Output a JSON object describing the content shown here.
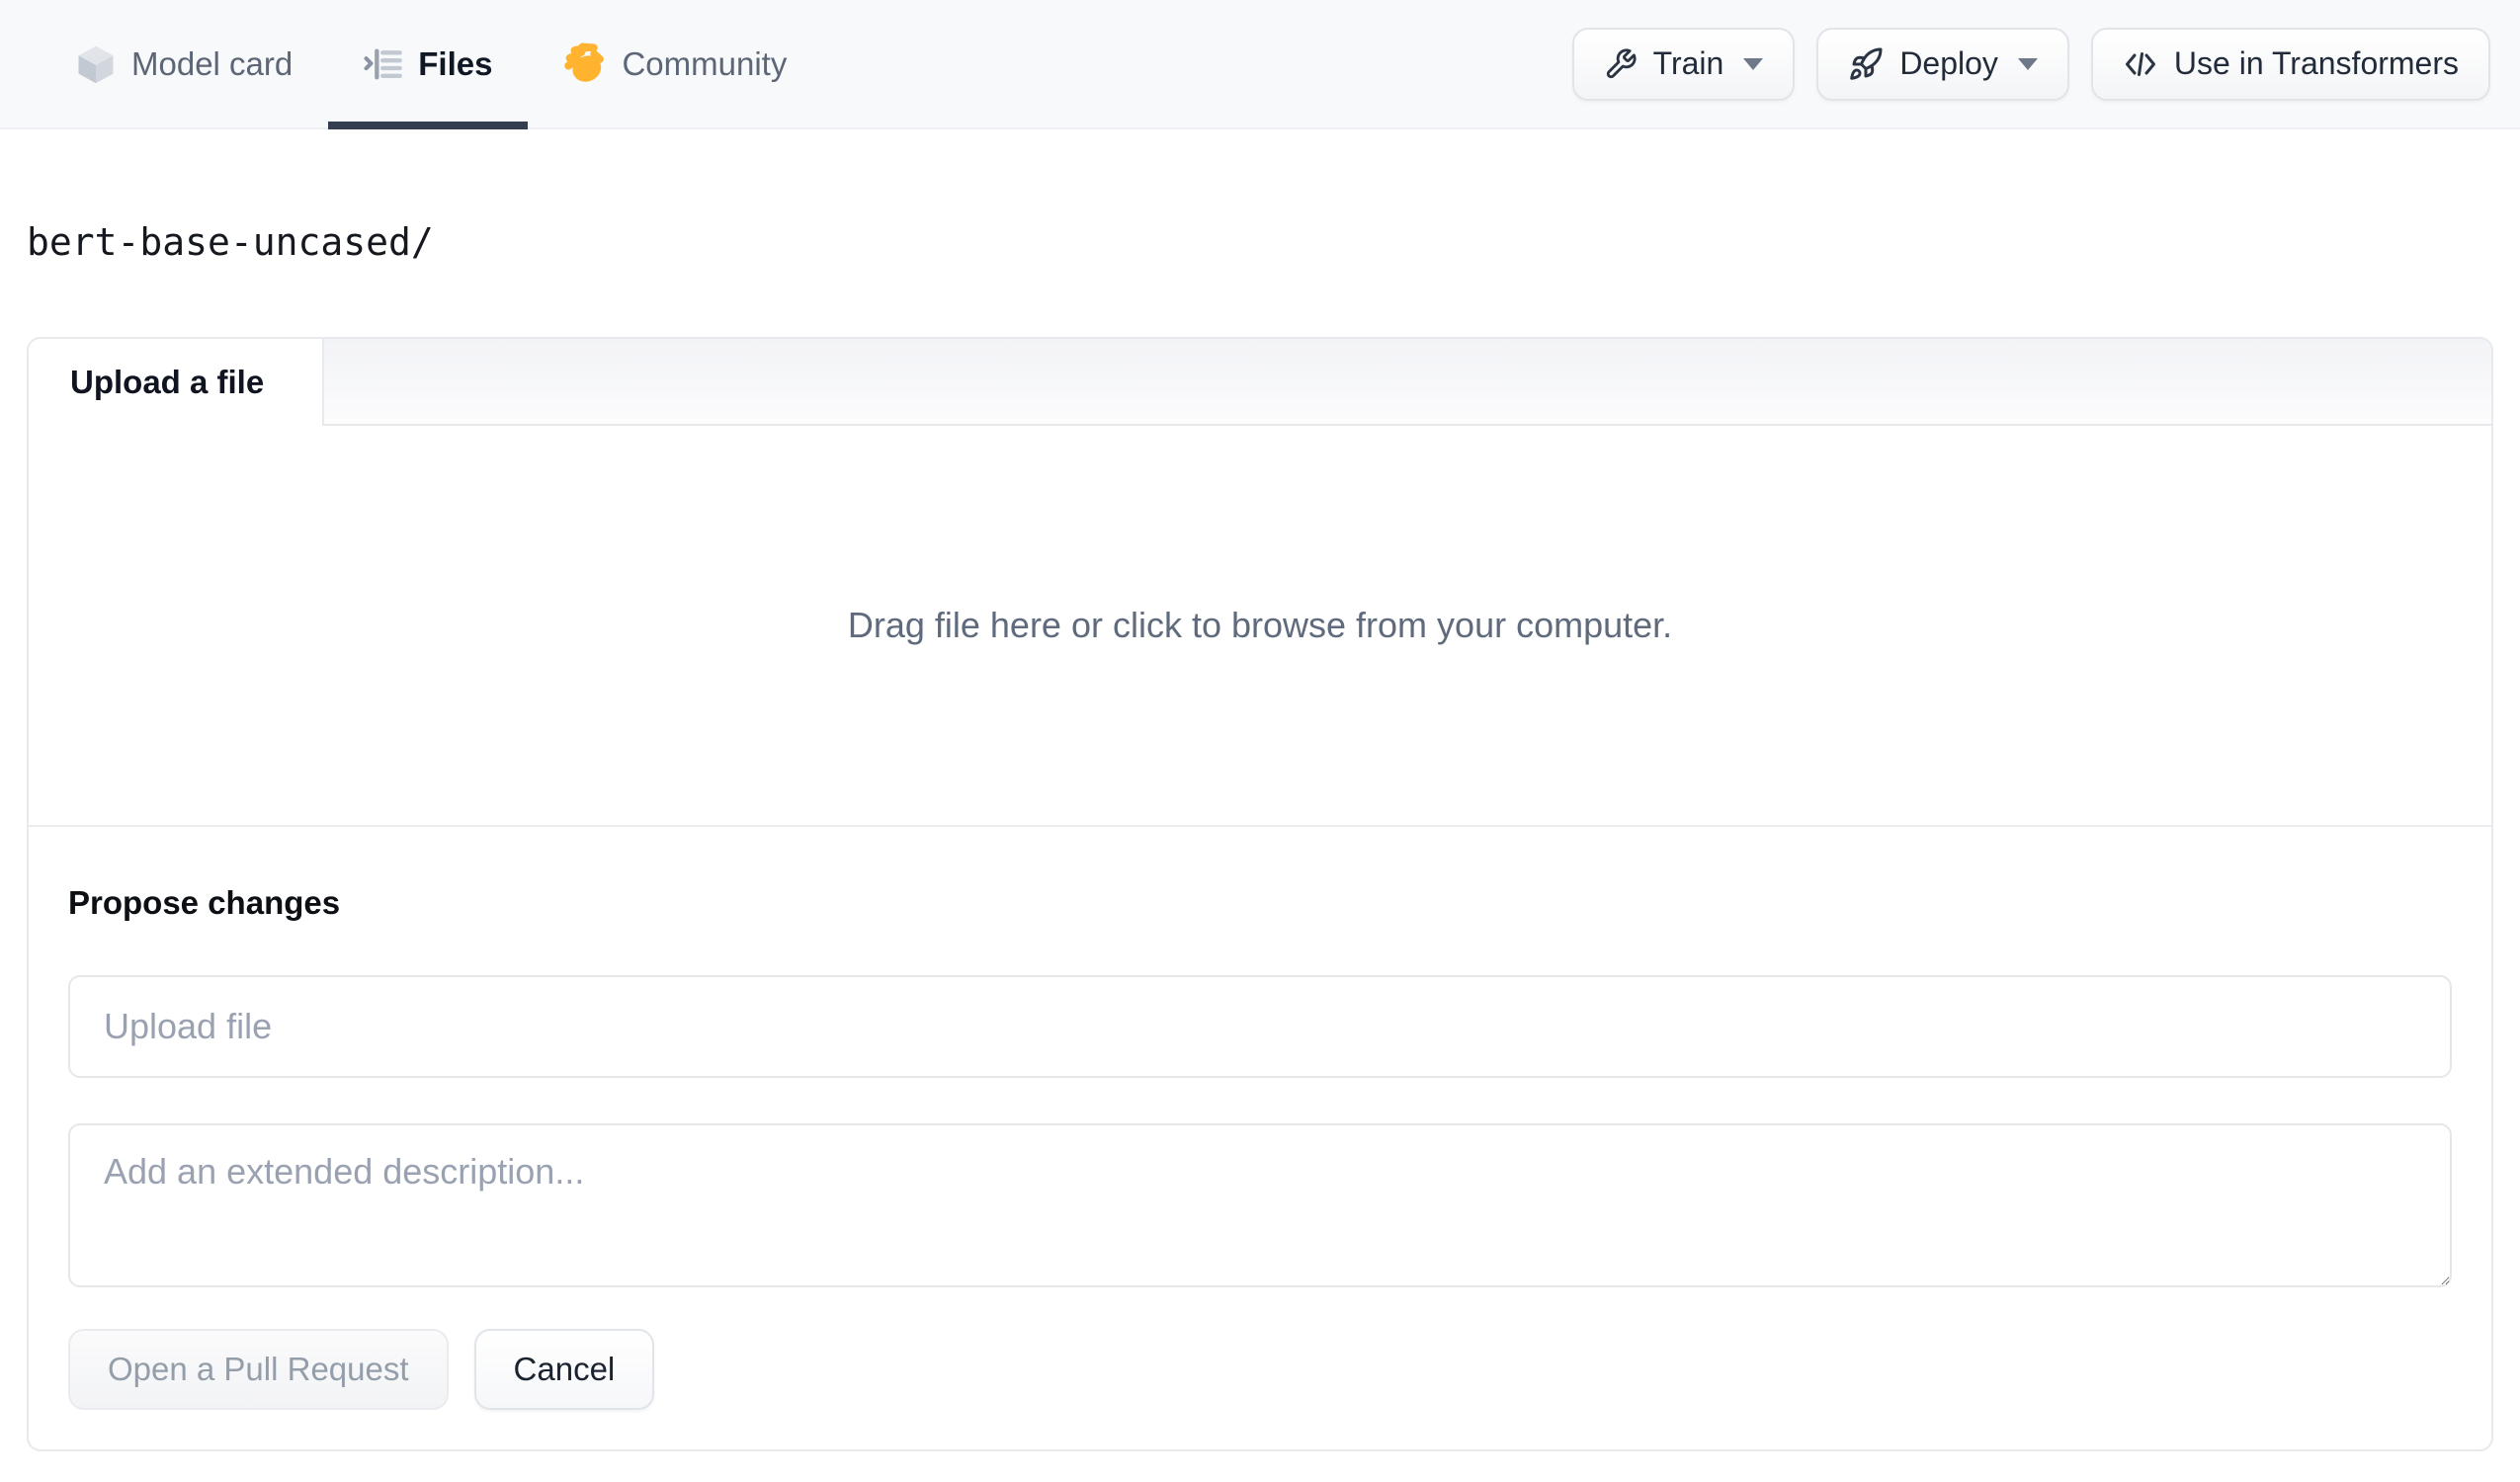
{
  "header": {
    "tabs": [
      {
        "label": "Model card",
        "icon": "cube-icon"
      },
      {
        "label": "Files",
        "icon": "file-versions-icon",
        "active": true
      },
      {
        "label": "Community",
        "icon": "waving-hand-icon"
      }
    ],
    "actions": {
      "train_label": "Train",
      "deploy_label": "Deploy",
      "use_in_transformers_label": "Use in Transformers"
    }
  },
  "breadcrumb": {
    "path": "bert-base-uncased/"
  },
  "upload_card": {
    "tab_label": "Upload a file",
    "dropzone_text": "Drag file here or click to browse from your computer.",
    "propose_heading": "Propose changes",
    "filename_placeholder": "Upload file",
    "filename_value": "",
    "description_placeholder": "Add an extended description...",
    "description_value": "",
    "open_pr_label": "Open a Pull Request",
    "cancel_label": "Cancel"
  },
  "colors": {
    "header_bg": "#f8f9fb",
    "active_tab_underline": "#353e4e",
    "card_border": "#e7e9ed",
    "muted_text": "#5f6b7c",
    "placeholder_text": "#9aa2b1",
    "dark_text": "#101725",
    "hand_emoji_yellow": "#ffb32e"
  }
}
